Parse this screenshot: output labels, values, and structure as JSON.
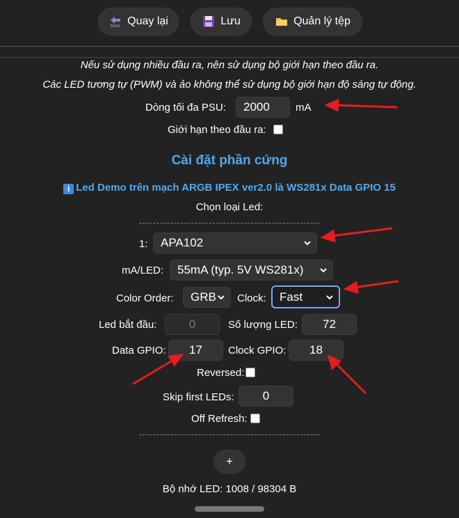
{
  "toolbar": {
    "back_label": "Quay lại",
    "save_label": "Lưu",
    "files_label": "Quản lý tệp"
  },
  "notes": {
    "line1": "Nếu sử dụng nhiều đầu ra, nên sử dụng bộ giới hạn theo đầu ra.",
    "line2": "Các LED tương tự (PWM) và ảo không thể sử dụng bộ giới hạn độ sáng tự động."
  },
  "psu": {
    "label": "Dòng tối đa PSU:",
    "value": "2000",
    "unit": "mA",
    "per_output_label": "Giới hạn theo đầu ra:",
    "per_output_checked": false
  },
  "hardware": {
    "title": "Cài đặt phần cứng",
    "info": "Led Demo trên mạch ARGB IPEX ver2.0 là WS281x Data GPIO 15",
    "choose_type_label": "Chọn loại Led:"
  },
  "led_output": {
    "index_label": "1:",
    "type": "APA102",
    "ma_label": "mA/LED:",
    "ma_value": "55mA (typ. 5V WS281x)",
    "color_order_label": "Color Order:",
    "color_order": "GRB",
    "clock_label": "Clock:",
    "clock": "Fast",
    "start_label": "Led bắt đầu:",
    "start_value": "0",
    "count_label": "Số lượng LED:",
    "count_value": "72",
    "data_gpio_label": "Data GPIO:",
    "data_gpio_value": "17",
    "clock_gpio_label": "Clock GPIO:",
    "clock_gpio_value": "18",
    "reversed_label": "Reversed:",
    "reversed_checked": false,
    "skip_label": "Skip first LEDs:",
    "skip_value": "0",
    "off_refresh_label": "Off Refresh:",
    "off_refresh_checked": false
  },
  "add_button_label": "+",
  "memory": {
    "text": "Bộ nhớ LED: 1008 / 98304 B"
  },
  "colors": {
    "background": "#222222",
    "accent": "#4fa9f0",
    "annotation_arrow": "#e41e1e"
  }
}
